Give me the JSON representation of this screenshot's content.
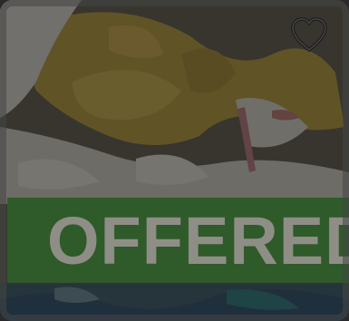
{
  "listing": {
    "status_label": "OFFERED",
    "status_color": "#2f5a2a",
    "favorite_icon": "heart-outline-icon",
    "image_subject": "garden-waste-photo"
  }
}
